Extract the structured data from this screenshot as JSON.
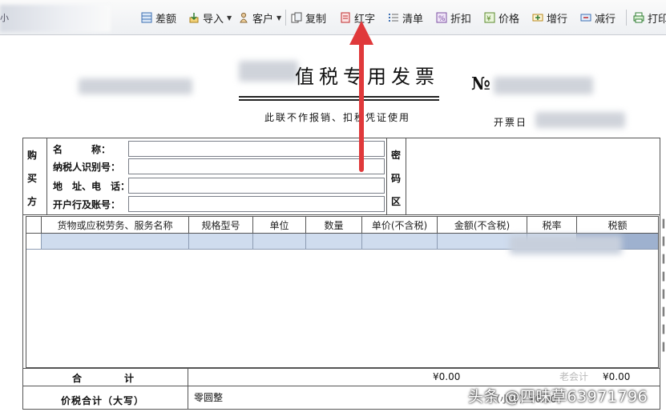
{
  "toolbar": {
    "edge_glyph": "小",
    "items": [
      {
        "label": "差额",
        "icon": "table-icon"
      },
      {
        "label": "导入",
        "icon": "import-icon",
        "dropdown": true
      },
      {
        "label": "客户",
        "icon": "customer-icon",
        "dropdown": true
      },
      {
        "label": "复制",
        "icon": "copy-icon"
      },
      {
        "label": "红字",
        "icon": "red-letter-icon"
      },
      {
        "label": "清单",
        "icon": "list-icon"
      },
      {
        "label": "折扣",
        "icon": "discount-icon"
      },
      {
        "label": "价格",
        "icon": "price-icon"
      },
      {
        "label": "增行",
        "icon": "add-row-icon"
      },
      {
        "label": "减行",
        "icon": "remove-row-icon"
      },
      {
        "label": "打印",
        "icon": "print-icon"
      }
    ]
  },
  "invoice": {
    "title": "值税专用发票",
    "subtitle": "此联不作报销、扣税凭证使用",
    "number_mark": "№",
    "date_label": "开票日",
    "buyer_side": [
      "购",
      "买",
      "方"
    ],
    "buyer_fields": [
      {
        "label": "名　　　称：",
        "value": ""
      },
      {
        "label": "纳税人识别号：",
        "value": ""
      },
      {
        "label": "地　址、电　话：",
        "value": ""
      },
      {
        "label": "开户行及账号：",
        "value": ""
      }
    ],
    "cipher_side": [
      "密",
      "码",
      "区"
    ],
    "columns": [
      "货物或应税劳务、服务名称",
      "规格型号",
      "单位",
      "数量",
      "单价(不含税)",
      "金额(不含税)",
      "税率",
      "税额"
    ],
    "total_label": "合　　　　计",
    "total_amount": "¥0.00",
    "total_tax": "¥0.00",
    "grand_label": "价税合计（大写）",
    "grand_value": "零圆整",
    "grand_small": "（小写）¥0.00"
  },
  "watermark": {
    "text": "头条 @四味草63971796",
    "faded": "老会计"
  },
  "colors": {
    "arrow": "#e0393b",
    "row_highlight": "#cfdcee",
    "row_selected": "#9eb1cf"
  }
}
